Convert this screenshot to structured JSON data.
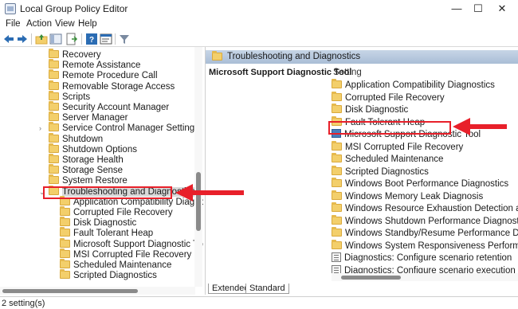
{
  "window": {
    "title": "Local Group Policy Editor",
    "minimize": "—",
    "maximize": "☐",
    "close": "✕"
  },
  "menu": {
    "items": [
      "File",
      "Action",
      "View",
      "Help"
    ]
  },
  "toolbar": {
    "icons": [
      "back-icon",
      "forward-icon",
      "up-folder-icon",
      "show-hide-tree-icon",
      "export-list-icon",
      "help-icon",
      "properties-icon",
      "filter-icon"
    ]
  },
  "tree": {
    "items": [
      {
        "label": "Recovery",
        "indent": 1
      },
      {
        "label": "Remote Assistance",
        "indent": 1
      },
      {
        "label": "Remote Procedure Call",
        "indent": 1
      },
      {
        "label": "Removable Storage Access",
        "indent": 1
      },
      {
        "label": "Scripts",
        "indent": 1
      },
      {
        "label": "Security Account Manager",
        "indent": 1
      },
      {
        "label": "Server Manager",
        "indent": 1
      },
      {
        "label": "Service Control Manager Settings",
        "indent": 1,
        "expander": "›"
      },
      {
        "label": "Shutdown",
        "indent": 1
      },
      {
        "label": "Shutdown Options",
        "indent": 1
      },
      {
        "label": "Storage Health",
        "indent": 1
      },
      {
        "label": "Storage Sense",
        "indent": 1
      },
      {
        "label": "System Restore",
        "indent": 1
      },
      {
        "label": "Troubleshooting and Diagnostics",
        "indent": 1,
        "expander": "⌄",
        "selected": true
      },
      {
        "label": "Application Compatibility Diagnostics",
        "indent": 2
      },
      {
        "label": "Corrupted File Recovery",
        "indent": 2
      },
      {
        "label": "Disk Diagnostic",
        "indent": 2
      },
      {
        "label": "Fault Tolerant Heap",
        "indent": 2
      },
      {
        "label": "Microsoft Support Diagnostic Tool",
        "indent": 2
      },
      {
        "label": "MSI Corrupted File Recovery",
        "indent": 2
      },
      {
        "label": "Scheduled Maintenance",
        "indent": 2
      },
      {
        "label": "Scripted Diagnostics",
        "indent": 2
      }
    ]
  },
  "right_pane": {
    "header": "Troubleshooting and Diagnostics",
    "description_title": "Microsoft Support Diagnostic Tool",
    "column_header": "Setting",
    "items": [
      {
        "label": "Application Compatibility Diagnostics",
        "icon": "folder"
      },
      {
        "label": "Corrupted File Recovery",
        "icon": "folder"
      },
      {
        "label": "Disk Diagnostic",
        "icon": "folder"
      },
      {
        "label": "Fault Tolerant Heap",
        "icon": "folder"
      },
      {
        "label": "Microsoft Support Diagnostic Tool",
        "icon": "tool",
        "selected": true
      },
      {
        "label": "MSI Corrupted File Recovery",
        "icon": "folder"
      },
      {
        "label": "Scheduled Maintenance",
        "icon": "folder"
      },
      {
        "label": "Scripted Diagnostics",
        "icon": "folder"
      },
      {
        "label": "Windows Boot Performance Diagnostics",
        "icon": "folder"
      },
      {
        "label": "Windows Memory Leak Diagnosis",
        "icon": "folder"
      },
      {
        "label": "Windows Resource Exhaustion Detection and Resolution",
        "icon": "folder"
      },
      {
        "label": "Windows Shutdown Performance Diagnostics",
        "icon": "folder"
      },
      {
        "label": "Windows Standby/Resume Performance Diagnostics",
        "icon": "folder"
      },
      {
        "label": "Windows System Responsiveness Performance Diagnostics",
        "icon": "folder"
      },
      {
        "label": "Diagnostics: Configure scenario retention",
        "icon": "setting"
      },
      {
        "label": "Diagnostics: Configure scenario execution level",
        "icon": "setting"
      }
    ],
    "tabs": [
      "Extended",
      "Standard"
    ]
  },
  "status": {
    "text": "2 setting(s)"
  },
  "annotation_color": "#e8202a"
}
